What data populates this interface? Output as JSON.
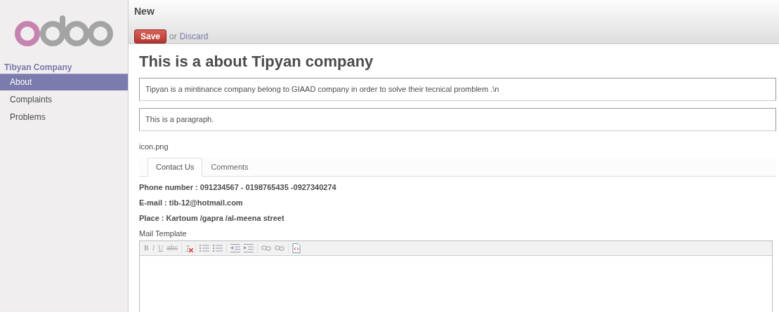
{
  "sidebar": {
    "section": "Tibyan Company",
    "items": [
      {
        "label": "About",
        "selected": true
      },
      {
        "label": "Complaints",
        "selected": false
      },
      {
        "label": "Problems",
        "selected": false
      }
    ]
  },
  "header": {
    "title": "New",
    "save": "Save",
    "or": "or",
    "discard": "Discard"
  },
  "form": {
    "title": "This is a about Tipyan company",
    "fields": [
      "Tipyan is a mintinance company belong to GIAAD company in order to solve their tecnical promblem .\\n",
      "This is a paragraph."
    ],
    "file": "icon.png",
    "tabs": [
      {
        "label": "Contact Us",
        "selected": true
      },
      {
        "label": "Comments",
        "selected": false
      }
    ],
    "contact": [
      "Phone number : 091234567 - 0198765435 -0927340274",
      "E-mail : tib-12@hotmail.com",
      "Place : Kartoum /gapra /al-meena street"
    ],
    "editor": {
      "label": "Mail Template",
      "tools": [
        {
          "kind": "bold",
          "label": "B"
        },
        {
          "kind": "italic",
          "label": "I"
        },
        {
          "kind": "underline",
          "label": "U"
        },
        {
          "kind": "strike",
          "label": "abc"
        },
        {
          "kind": "clear",
          "label": "T"
        },
        {
          "kind": "bullets"
        },
        {
          "kind": "numbers"
        },
        {
          "kind": "outdent"
        },
        {
          "kind": "indent"
        },
        {
          "kind": "link"
        },
        {
          "kind": "unlink"
        },
        {
          "kind": "source"
        }
      ]
    }
  }
}
